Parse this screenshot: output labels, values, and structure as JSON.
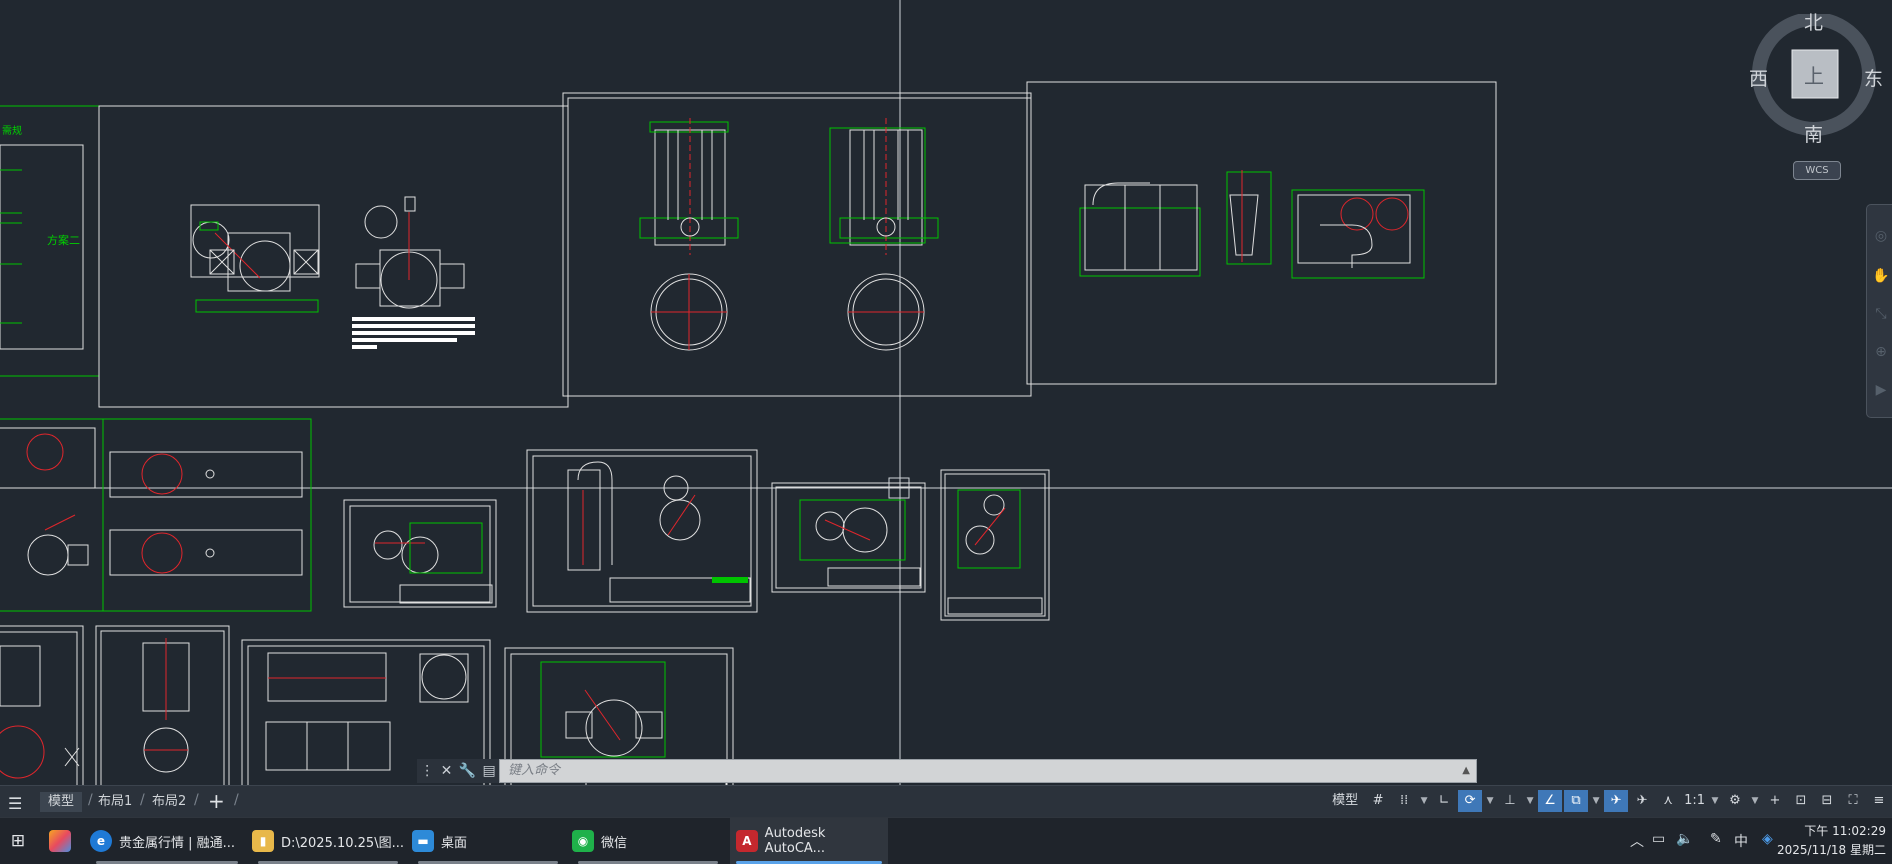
{
  "viewcube": {
    "north": "北",
    "south": "南",
    "east": "东",
    "west": "西",
    "face": "上",
    "wcs": "WCS"
  },
  "drawing": {
    "text_scheme": "方案二",
    "text_top": "需规"
  },
  "command_line": {
    "placeholder": "键入命令"
  },
  "layout_tabs": [
    {
      "label": "模型",
      "active": true
    },
    {
      "label": "布局1",
      "active": false
    },
    {
      "label": "布局2",
      "active": false
    }
  ],
  "statusbar": {
    "model": "模型",
    "scale": "1:1"
  },
  "taskbar": {
    "items": [
      {
        "label": "贵金属行情 | 融通...",
        "icon": "e",
        "color": "#1f7ad6"
      },
      {
        "label": "D:\\2025.10.25\\图...",
        "icon": "▮",
        "color": "#e8b84a"
      },
      {
        "label": "桌面",
        "icon": "▬",
        "color": "#2d8ad8"
      },
      {
        "label": "微信",
        "icon": "◉",
        "color": "#1fb14a"
      },
      {
        "label": "Autodesk AutoCA...",
        "icon": "A",
        "color": "#c4282e"
      }
    ],
    "ime": "中",
    "time": "下午 11:02:29",
    "date": "2025/11/18 星期二"
  },
  "colors": {
    "bg": "#212830",
    "lines": "#ffffff",
    "green": "#00d100",
    "red": "#e0262c",
    "accent": "#3f78b8"
  }
}
